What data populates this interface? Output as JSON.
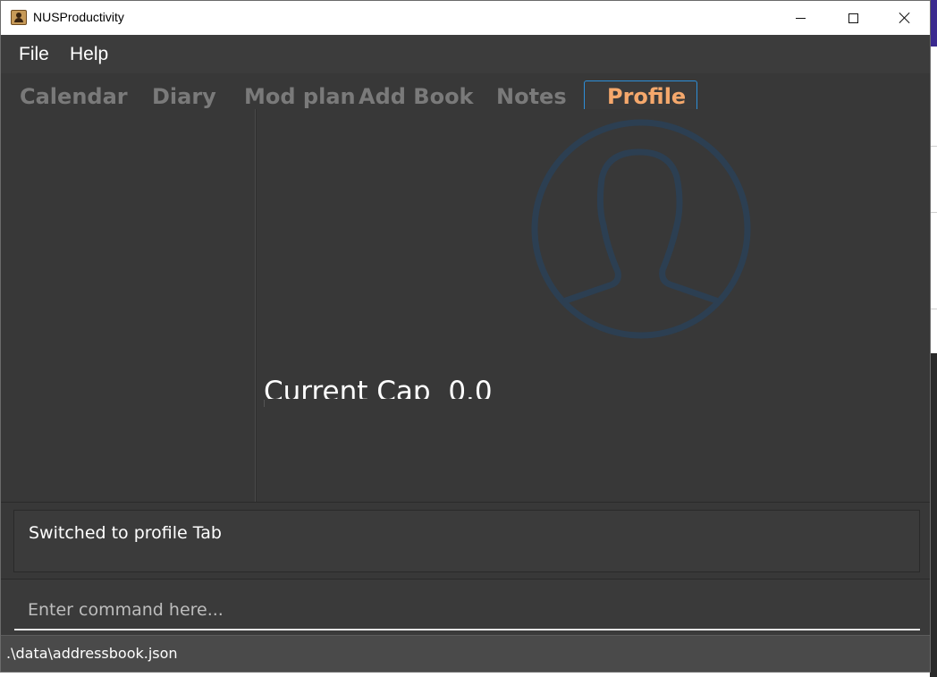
{
  "window": {
    "title": "NUSProductivity",
    "icon": "address-book-icon"
  },
  "menu": {
    "items": [
      {
        "label": "File"
      },
      {
        "label": "Help"
      }
    ]
  },
  "tabs": {
    "items": [
      {
        "label": "Calendar",
        "selected": false
      },
      {
        "label": "Diary",
        "selected": false
      },
      {
        "label": "Mod plan",
        "selected": false
      },
      {
        "label": "Add Book",
        "selected": false
      },
      {
        "label": "Notes",
        "selected": false
      },
      {
        "label": "Profile",
        "selected": true
      }
    ],
    "selected_color": "#f5a86c",
    "unselected_color": "#7a7a7a",
    "selected_border_color": "#2d8fd8"
  },
  "profile": {
    "avatar_icon": "user-silhouette-icon",
    "avatar_color": "#2c3f52",
    "cap_label": "Current Cap",
    "cap_value": "0.0"
  },
  "result": {
    "message": "Switched to profile Tab"
  },
  "command": {
    "placeholder": "Enter command here...",
    "value": ""
  },
  "status": {
    "file_path": ".\\data\\addressbook.json"
  }
}
